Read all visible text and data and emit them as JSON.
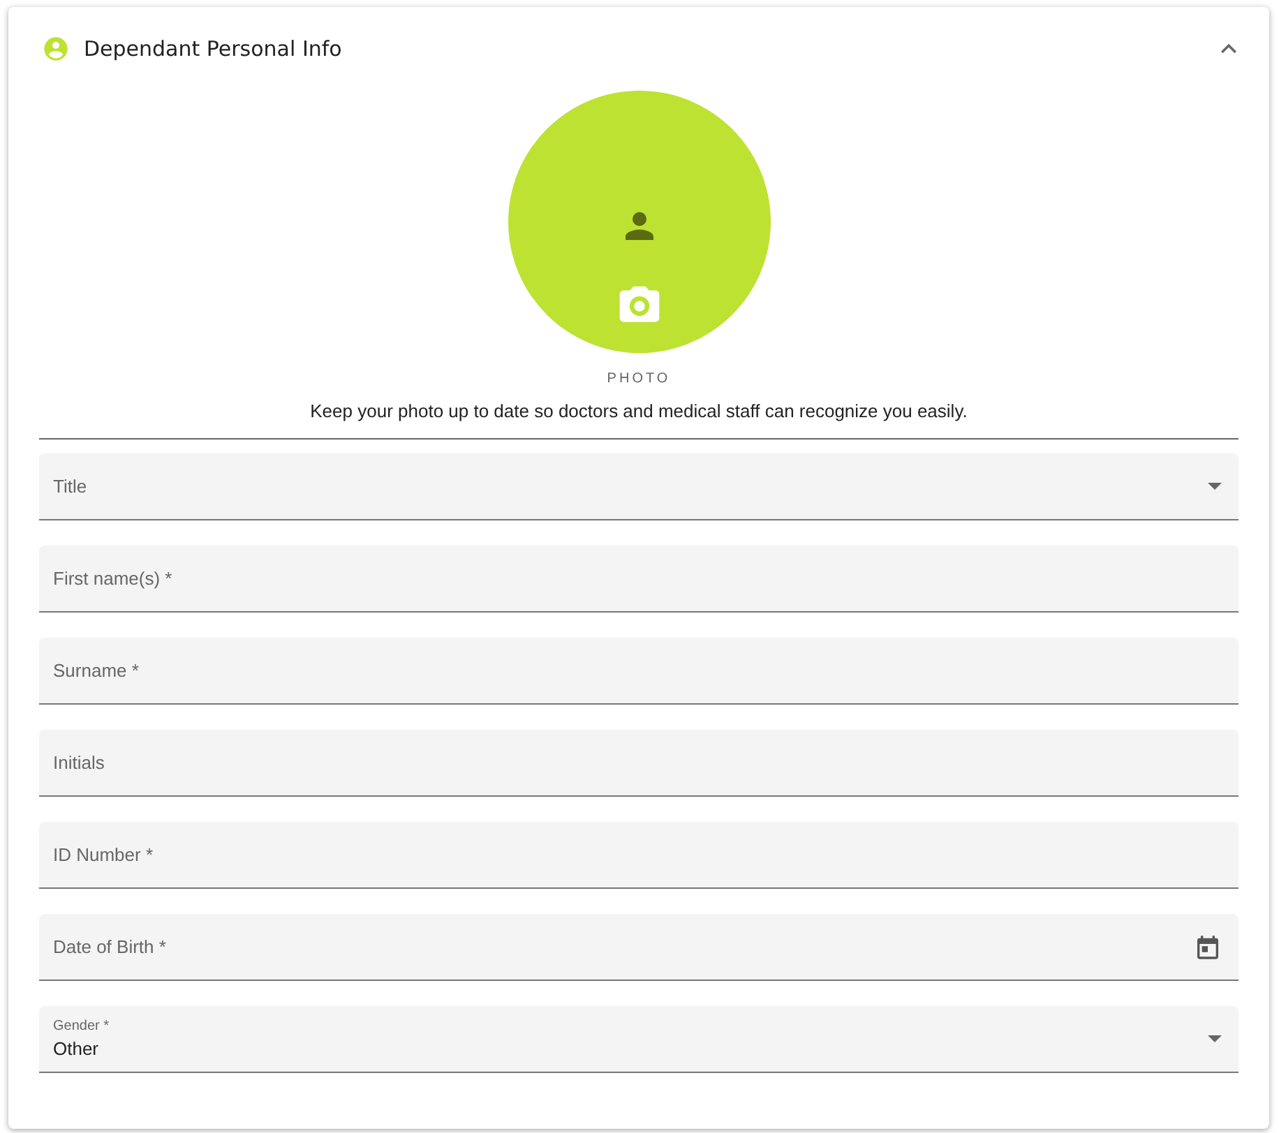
{
  "panel": {
    "title": "Dependant Personal Info",
    "expanded": true
  },
  "photo": {
    "label": "PHOTO",
    "hint": "Keep your photo up to date so doctors and medical staff can recognize you easily."
  },
  "fields": [
    {
      "kind": "select",
      "label": "Title"
    },
    {
      "kind": "text",
      "label": "First name(s) *"
    },
    {
      "kind": "text",
      "label": "Surname *"
    },
    {
      "kind": "text",
      "label": "Initials"
    },
    {
      "kind": "text",
      "label": "ID Number *"
    },
    {
      "kind": "date",
      "label": "Date of Birth *"
    },
    {
      "kind": "select",
      "label": "Gender *",
      "value": "Other"
    }
  ]
}
